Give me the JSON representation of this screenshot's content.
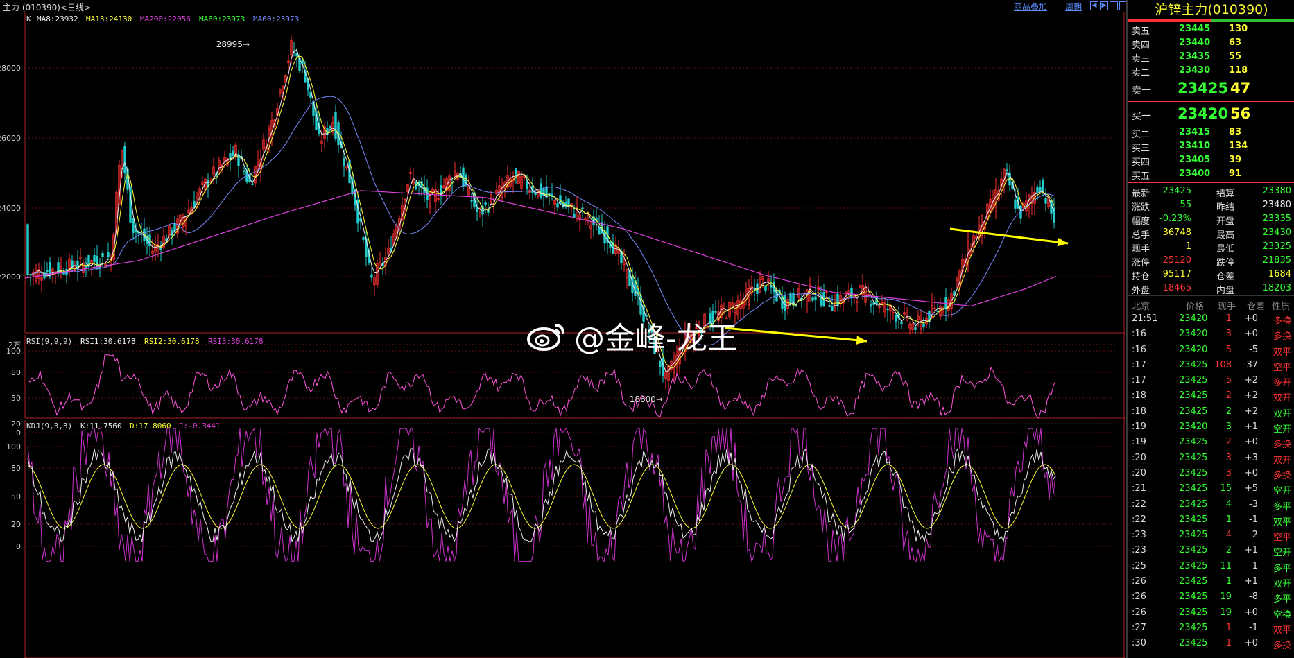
{
  "header": {
    "title": "主力 (010390)<日线>",
    "links": [
      "商品叠加",
      "周期"
    ],
    "window_buttons": [
      "prev",
      "next",
      "min",
      "max"
    ]
  },
  "ma_legend": [
    {
      "label": "K",
      "color": "#dddddd"
    },
    {
      "label": "MA8:23932",
      "color": "#eeeeee"
    },
    {
      "label": "MA13:24130",
      "color": "#ffff33"
    },
    {
      "label": "MA200:22056",
      "color": "#e040e0"
    },
    {
      "label": "MA60:23973",
      "color": "#33ff33"
    },
    {
      "label": "MA60:23973",
      "color": "#7a8cff"
    }
  ],
  "price_axis": [
    "28000",
    "26000",
    "24000",
    "22000",
    "2万"
  ],
  "annotations": {
    "high": "28995→",
    "low": "18600→"
  },
  "rsi": {
    "legend": [
      {
        "label": "RSI(9,9,9)",
        "color": "#dddddd"
      },
      {
        "label": "RSI1:30.6178",
        "color": "#eeeeee"
      },
      {
        "label": "RSI2:30.6178",
        "color": "#ffff33"
      },
      {
        "label": "RSI3:30.6178",
        "color": "#e040e0"
      }
    ],
    "axis": [
      "100",
      "80",
      "50",
      "20",
      "0"
    ]
  },
  "kdj": {
    "legend": [
      {
        "label": "KDJ(9,3,3)",
        "color": "#dddddd"
      },
      {
        "label": "K:11.7560",
        "color": "#eeeeee"
      },
      {
        "label": "D:17.8060",
        "color": "#ffff33"
      },
      {
        "label": "J:-0.3441",
        "color": "#e040e0"
      }
    ],
    "axis": [
      "100",
      "80",
      "50",
      "20",
      "0"
    ]
  },
  "watermark": "@金峰-龙王",
  "panel": {
    "title": "沪锌主力(010390)",
    "asks": [
      {
        "label": "卖五",
        "price": "23445",
        "vol": "130"
      },
      {
        "label": "卖四",
        "price": "23440",
        "vol": "63"
      },
      {
        "label": "卖三",
        "price": "23435",
        "vol": "55"
      },
      {
        "label": "卖二",
        "price": "23430",
        "vol": "118"
      },
      {
        "label": "卖一",
        "price": "23425",
        "vol": "47"
      }
    ],
    "bids": [
      {
        "label": "买一",
        "price": "23420",
        "vol": "56"
      },
      {
        "label": "买二",
        "price": "23415",
        "vol": "83"
      },
      {
        "label": "买三",
        "price": "23410",
        "vol": "134"
      },
      {
        "label": "买四",
        "price": "23405",
        "vol": "39"
      },
      {
        "label": "买五",
        "price": "23400",
        "vol": "91"
      }
    ],
    "stats": [
      {
        "l1": "最新",
        "v1": "23425",
        "c1": "g",
        "l2": "结算",
        "v2": "23380",
        "c2": "g"
      },
      {
        "l1": "涨跌",
        "v1": "-55",
        "c1": "g",
        "l2": "昨结",
        "v2": "23480",
        "c2": "w"
      },
      {
        "l1": "幅度",
        "v1": "-0.23%",
        "c1": "g",
        "l2": "开盘",
        "v2": "23335",
        "c2": "g"
      },
      {
        "l1": "总手",
        "v1": "36748",
        "c1": "y",
        "l2": "最高",
        "v2": "23430",
        "c2": "g"
      },
      {
        "l1": "现手",
        "v1": "1",
        "c1": "y",
        "l2": "最低",
        "v2": "23325",
        "c2": "g"
      },
      {
        "l1": "涨停",
        "v1": "25120",
        "c1": "rd",
        "l2": "跌停",
        "v2": "21835",
        "c2": "g"
      },
      {
        "l1": "持仓",
        "v1": "95117",
        "c1": "y",
        "l2": "仓差",
        "v2": "1684",
        "c2": "y"
      },
      {
        "l1": "外盘",
        "v1": "18465",
        "c1": "rd",
        "l2": "内盘",
        "v2": "18203",
        "c2": "g"
      }
    ],
    "ticks_header": [
      "北京",
      "价格",
      "现手",
      "仓差",
      "性质"
    ],
    "ticks": [
      {
        "t": "21:51",
        "p": "23420",
        "v": "1",
        "vc": "rd",
        "d": "+0",
        "n": "多换",
        "nc": "rd"
      },
      {
        "t": ":16",
        "p": "23420",
        "v": "3",
        "vc": "rd",
        "d": "+0",
        "n": "多换",
        "nc": "rd"
      },
      {
        "t": ":16",
        "p": "23420",
        "v": "5",
        "vc": "rd",
        "d": "-5",
        "n": "双平",
        "nc": "rd"
      },
      {
        "t": ":17",
        "p": "23425",
        "v": "108",
        "vc": "rd",
        "d": "-37",
        "n": "空平",
        "nc": "rd"
      },
      {
        "t": ":17",
        "p": "23425",
        "v": "5",
        "vc": "rd",
        "d": "+2",
        "n": "多开",
        "nc": "rd"
      },
      {
        "t": ":18",
        "p": "23425",
        "v": "2",
        "vc": "rd",
        "d": "+2",
        "n": "双开",
        "nc": "rd"
      },
      {
        "t": ":18",
        "p": "23425",
        "v": "2",
        "vc": "g",
        "d": "+2",
        "n": "双开",
        "nc": "g"
      },
      {
        "t": ":19",
        "p": "23420",
        "v": "3",
        "vc": "g",
        "d": "+1",
        "n": "空开",
        "nc": "g"
      },
      {
        "t": ":19",
        "p": "23425",
        "v": "2",
        "vc": "rd",
        "d": "+0",
        "n": "多换",
        "nc": "rd"
      },
      {
        "t": ":20",
        "p": "23425",
        "v": "3",
        "vc": "rd",
        "d": "+3",
        "n": "双开",
        "nc": "rd"
      },
      {
        "t": ":20",
        "p": "23425",
        "v": "3",
        "vc": "rd",
        "d": "+0",
        "n": "多换",
        "nc": "rd"
      },
      {
        "t": ":21",
        "p": "23425",
        "v": "15",
        "vc": "g",
        "d": "+5",
        "n": "空开",
        "nc": "g"
      },
      {
        "t": ":22",
        "p": "23425",
        "v": "4",
        "vc": "g",
        "d": "-3",
        "n": "多平",
        "nc": "g"
      },
      {
        "t": ":22",
        "p": "23425",
        "v": "1",
        "vc": "g",
        "d": "-1",
        "n": "双平",
        "nc": "g"
      },
      {
        "t": ":23",
        "p": "23425",
        "v": "4",
        "vc": "rd",
        "d": "-2",
        "n": "空平",
        "nc": "rd"
      },
      {
        "t": ":23",
        "p": "23425",
        "v": "2",
        "vc": "g",
        "d": "+1",
        "n": "空开",
        "nc": "g"
      },
      {
        "t": ":25",
        "p": "23425",
        "v": "11",
        "vc": "g",
        "d": "-1",
        "n": "多平",
        "nc": "g"
      },
      {
        "t": ":26",
        "p": "23425",
        "v": "1",
        "vc": "g",
        "d": "+1",
        "n": "双开",
        "nc": "g"
      },
      {
        "t": ":26",
        "p": "23425",
        "v": "19",
        "vc": "g",
        "d": "-8",
        "n": "多平",
        "nc": "g"
      },
      {
        "t": ":26",
        "p": "23425",
        "v": "19",
        "vc": "g",
        "d": "+0",
        "n": "空换",
        "nc": "g"
      },
      {
        "t": ":27",
        "p": "23425",
        "v": "1",
        "vc": "rd",
        "d": "-1",
        "n": "双平",
        "nc": "rd"
      },
      {
        "t": ":30",
        "p": "23425",
        "v": "1",
        "vc": "rd",
        "d": "+0",
        "n": "多换",
        "nc": "rd"
      }
    ]
  }
}
